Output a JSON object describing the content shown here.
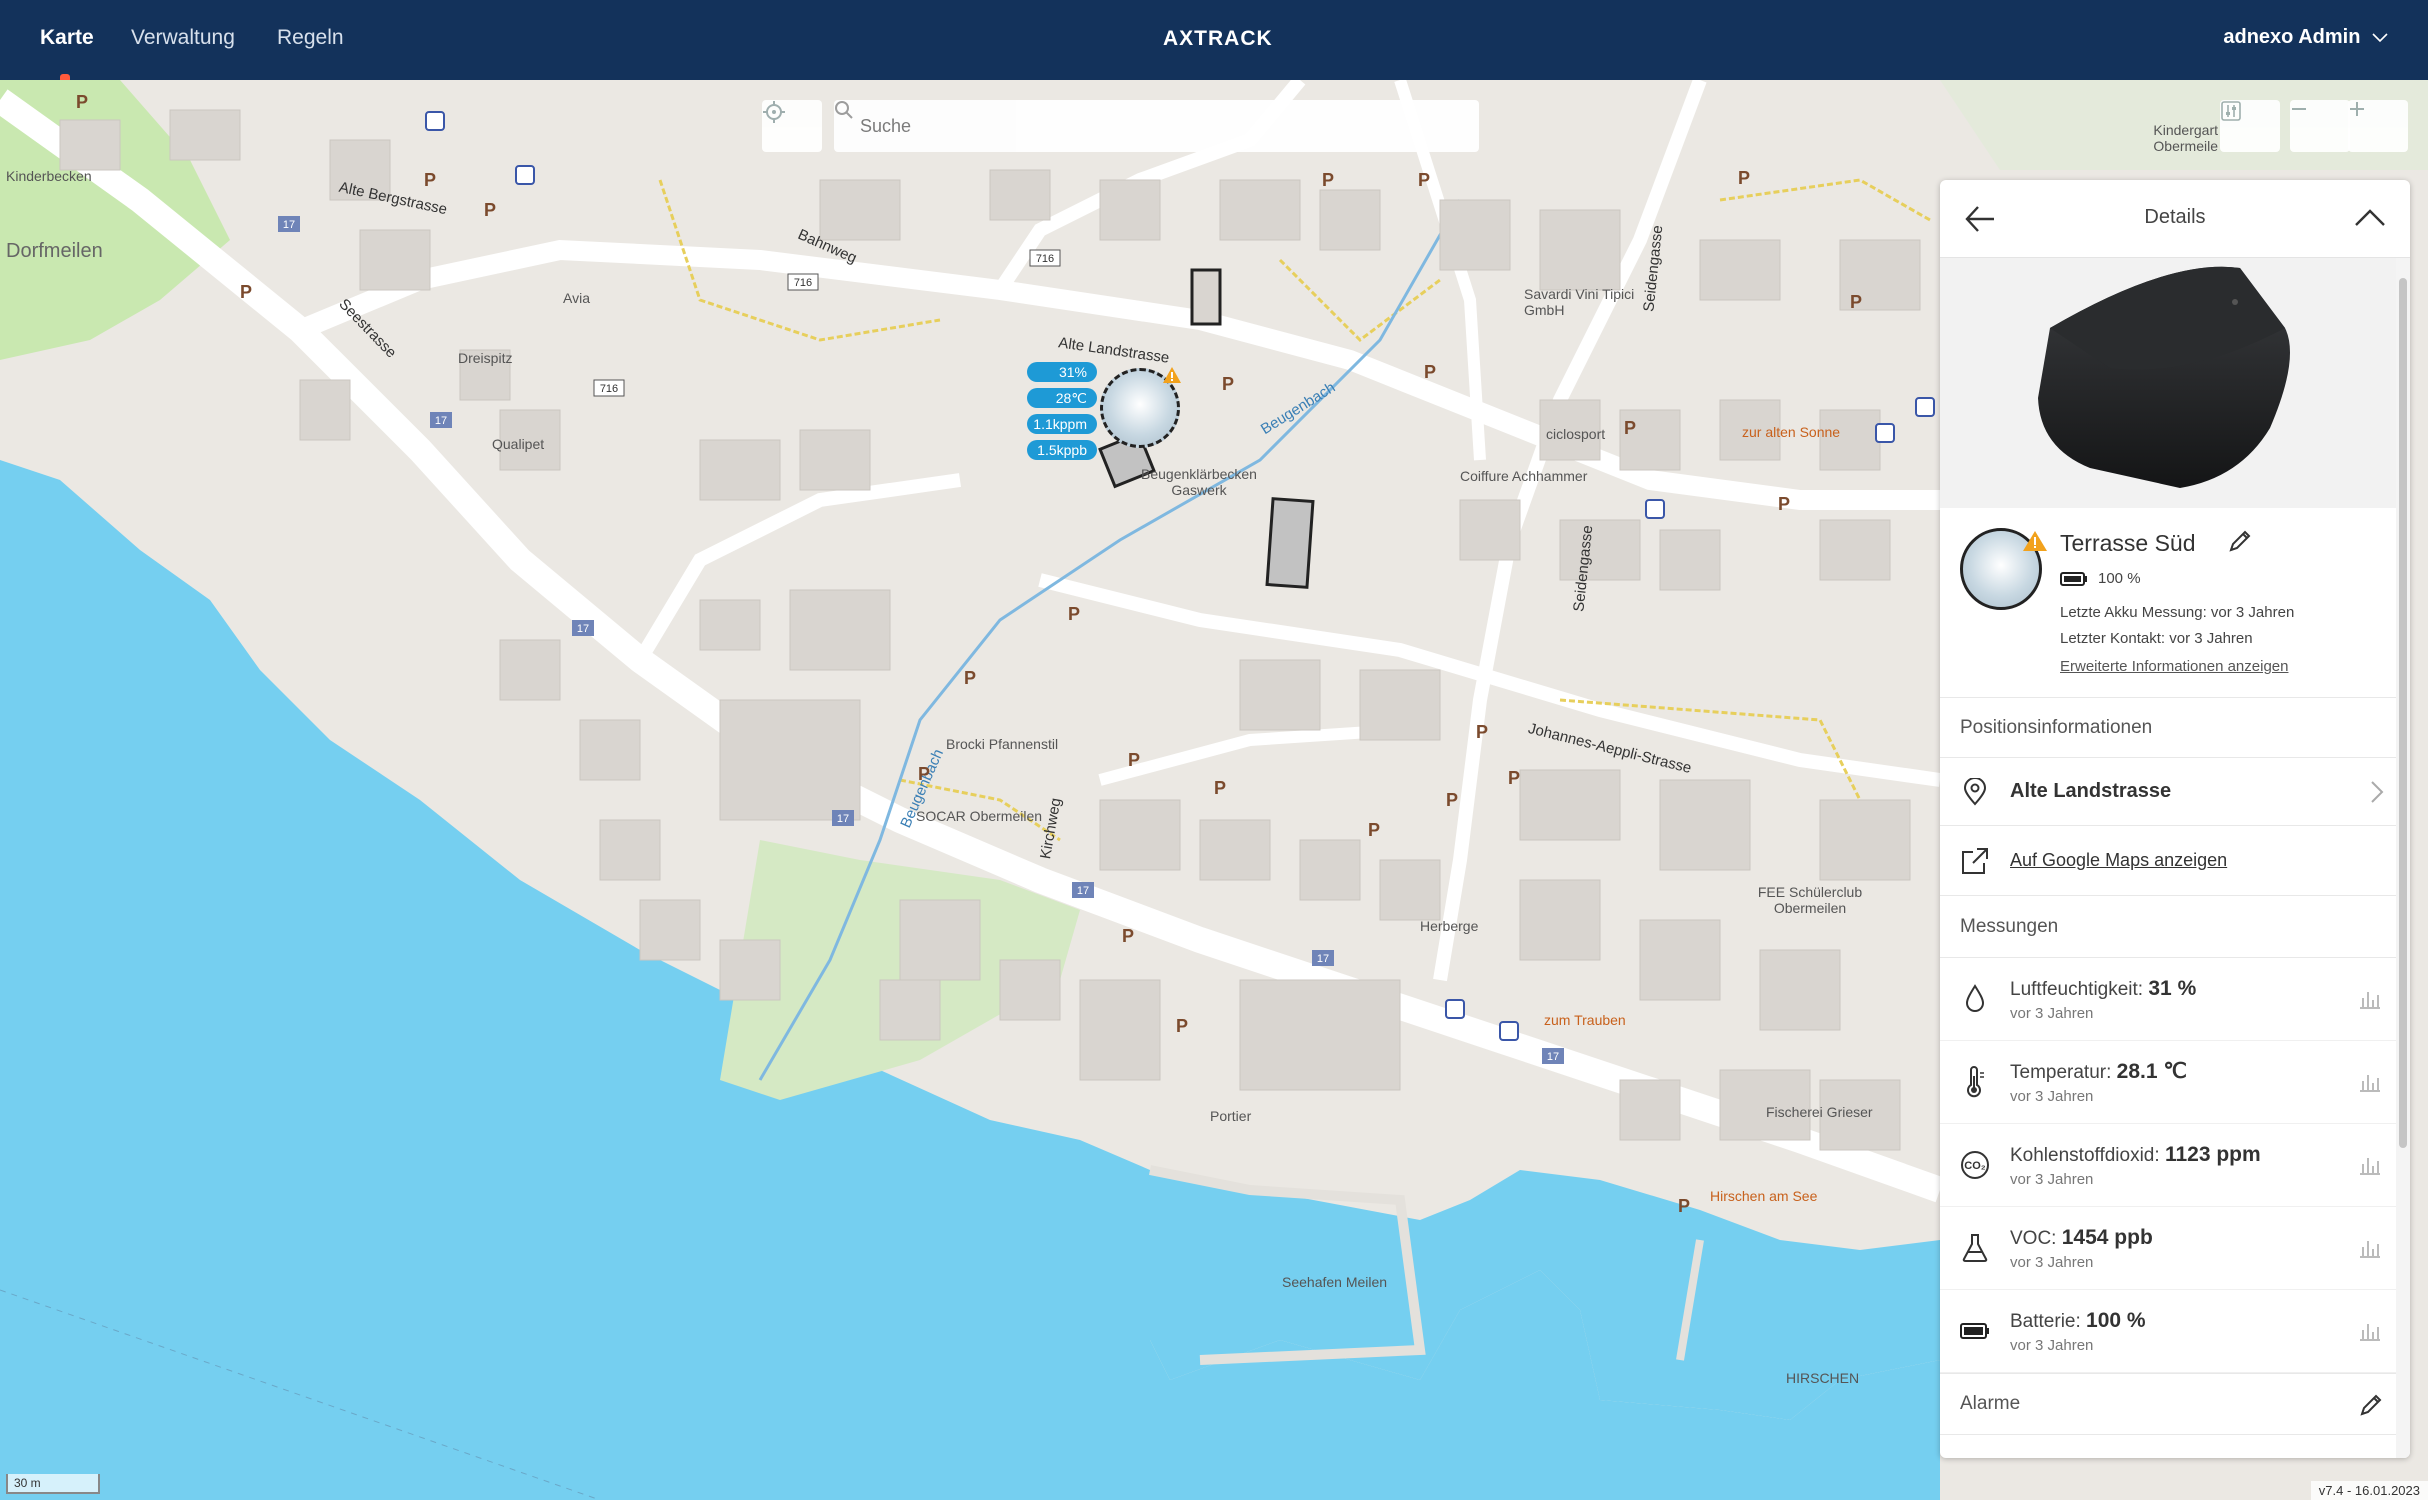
{
  "nav": {
    "items": [
      {
        "label": "Karte",
        "active": true
      },
      {
        "label": "Verwaltung",
        "active": false
      },
      {
        "label": "Regeln",
        "active": false
      }
    ],
    "brand": "AXTRACK",
    "user": "adnexo Admin"
  },
  "map": {
    "search_placeholder": "Suche",
    "scale_label": "30 m",
    "version": "v7.4 - 16.01.2023",
    "labels": {
      "kinderbecken": "Kinderbecken",
      "dorfmeilen": "Dorfmeilen",
      "alte_bergstrasse": "Alte Bergstrasse",
      "seestrasse": "Seestrasse",
      "bahnweg": "Bahnweg",
      "avia": "Avia",
      "dreispitz": "Dreispitz",
      "qualipet": "Qualipet",
      "alte_landstrasse": "Alte Landstrasse",
      "beugenbach_1": "Beugenbach",
      "beugenbach_2": "Beugenbach",
      "klaerbecken": "Beugenklärbecken Gaswerk",
      "savardi": "Savardi Vini Tipici GmbH",
      "ciclosport": "ciclosport",
      "coiffure": "Coiffure Achhammer",
      "zur_alten_sonne": "zur alten Sonne",
      "seidengasse": "Seidengasse",
      "kindergarten": "Kindergart Obermeile",
      "brocki": "Brocki Pfannenstil",
      "socar": "SOCAR Obermeilen",
      "kirchweg": "Kirchweg",
      "johannes": "Johannes-Aeppli-Strasse",
      "fee": "FEE Schülerclub Obermeilen",
      "herberge": "Herberge",
      "zum_trauben": "zum Trauben",
      "portier": "Portier",
      "fischerei": "Fischerei Grieser",
      "hirschen_see": "Hirschen am See",
      "seehafen": "Seehafen Meilen",
      "hirschen": "HIRSCHEN"
    },
    "route_badges": [
      "716",
      "716",
      "716",
      "17",
      "17",
      "17",
      "17",
      "17",
      "17",
      "17"
    ],
    "parking_symbol": "P",
    "sensor_pills": [
      "31%",
      "28℃",
      "1.1kppm",
      "1.5kppb"
    ]
  },
  "panel": {
    "title": "Details",
    "device_name": "Terrasse Süd",
    "battery": "100 %",
    "last_battery": "Letzte Akku Messung: vor 3 Jahren",
    "last_contact": "Letzter Kontakt: vor 3 Jahren",
    "more_info": "Erweiterte Informationen anzeigen",
    "position_title": "Positionsinformationen",
    "address": "Alte Landstrasse",
    "google_maps": "Auf Google Maps anzeigen",
    "measurements_title": "Messungen",
    "measurements": [
      {
        "label": "Luftfeuchtigkeit:",
        "value": "31 %",
        "time": "vor 3 Jahren",
        "icon": "drop-icon"
      },
      {
        "label": "Temperatur:",
        "value": "28.1 ℃",
        "time": "vor 3 Jahren",
        "icon": "thermometer-icon"
      },
      {
        "label": "Kohlenstoffdioxid:",
        "value": "1123 ppm",
        "time": "vor 3 Jahren",
        "icon": "co2-icon"
      },
      {
        "label": "VOC:",
        "value": "1454 ppb",
        "time": "vor 3 Jahren",
        "icon": "flask-icon"
      },
      {
        "label": "Batterie:",
        "value": "100 %",
        "time": "vor 3 Jahren",
        "icon": "battery-icon"
      }
    ],
    "alarms_title": "Alarme"
  },
  "colors": {
    "nav": "#13325b",
    "water": "#75cff0",
    "land": "#ebe8e3",
    "pill": "#1e9ad6"
  }
}
